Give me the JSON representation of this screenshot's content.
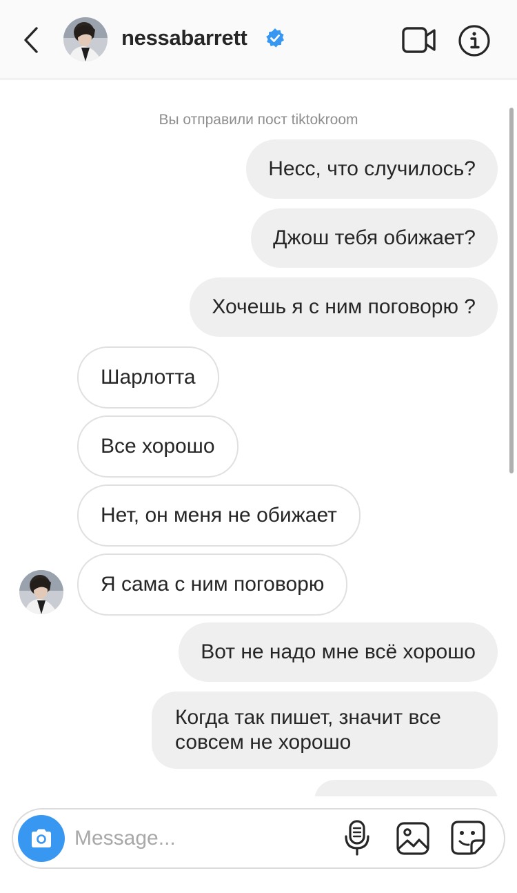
{
  "header": {
    "username": "nessabarrett",
    "verified": true,
    "icons": [
      "chevron-left-icon",
      "verified-badge-icon",
      "video-camera-icon",
      "info-icon"
    ]
  },
  "thread": {
    "system_note": "Вы отправили пост tiktokroom",
    "messages": [
      {
        "direction": "out",
        "text": "Несс, что случилось?"
      },
      {
        "direction": "out",
        "text": "Джош тебя обижает?"
      },
      {
        "direction": "out",
        "text": "Хочешь я с ним поговорю ?"
      },
      {
        "direction": "in",
        "text": "Шарлотта"
      },
      {
        "direction": "in",
        "text": "Все хорошо"
      },
      {
        "direction": "in",
        "text": "Нет, он меня не обижает"
      },
      {
        "direction": "in",
        "text": "Я сама с ним поговорю"
      },
      {
        "direction": "out",
        "text": "Вот не надо мне всё хорошо"
      },
      {
        "direction": "out",
        "text": "Когда так пишет, значит все совсем не хорошо"
      }
    ]
  },
  "composer": {
    "placeholder": "Message...",
    "value": "",
    "icons": [
      "camera-icon",
      "microphone-icon",
      "gallery-icon",
      "sticker-icon"
    ]
  },
  "colors": {
    "accent": "#3897f0",
    "verified": "#3897f0",
    "outgoing_bubble": "#efefef",
    "incoming_border": "#e0e0e0",
    "text": "#262626",
    "muted": "#8e8e8e"
  }
}
